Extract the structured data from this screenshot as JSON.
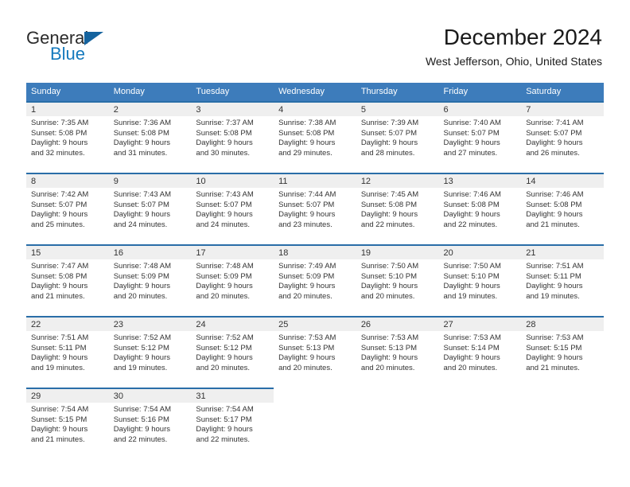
{
  "brand": {
    "name_part1": "General",
    "name_part2": "Blue",
    "triangle_icon": "triangle-icon",
    "accent_color": "#1479bd",
    "header_color": "#3d7cbb"
  },
  "header": {
    "title": "December 2024",
    "subtitle": "West Jefferson, Ohio, United States"
  },
  "calendar": {
    "weekday_headers": [
      "Sunday",
      "Monday",
      "Tuesday",
      "Wednesday",
      "Thursday",
      "Friday",
      "Saturday"
    ],
    "labels": {
      "sunrise_prefix": "Sunrise:",
      "sunset_prefix": "Sunset:",
      "daylight_prefix": "Daylight:"
    },
    "weeks": [
      [
        {
          "day": "1",
          "line1": "Sunrise: 7:35 AM",
          "line2": "Sunset: 5:08 PM",
          "line3": "Daylight: 9 hours",
          "line4": "and 32 minutes."
        },
        {
          "day": "2",
          "line1": "Sunrise: 7:36 AM",
          "line2": "Sunset: 5:08 PM",
          "line3": "Daylight: 9 hours",
          "line4": "and 31 minutes."
        },
        {
          "day": "3",
          "line1": "Sunrise: 7:37 AM",
          "line2": "Sunset: 5:08 PM",
          "line3": "Daylight: 9 hours",
          "line4": "and 30 minutes."
        },
        {
          "day": "4",
          "line1": "Sunrise: 7:38 AM",
          "line2": "Sunset: 5:08 PM",
          "line3": "Daylight: 9 hours",
          "line4": "and 29 minutes."
        },
        {
          "day": "5",
          "line1": "Sunrise: 7:39 AM",
          "line2": "Sunset: 5:07 PM",
          "line3": "Daylight: 9 hours",
          "line4": "and 28 minutes."
        },
        {
          "day": "6",
          "line1": "Sunrise: 7:40 AM",
          "line2": "Sunset: 5:07 PM",
          "line3": "Daylight: 9 hours",
          "line4": "and 27 minutes."
        },
        {
          "day": "7",
          "line1": "Sunrise: 7:41 AM",
          "line2": "Sunset: 5:07 PM",
          "line3": "Daylight: 9 hours",
          "line4": "and 26 minutes."
        }
      ],
      [
        {
          "day": "8",
          "line1": "Sunrise: 7:42 AM",
          "line2": "Sunset: 5:07 PM",
          "line3": "Daylight: 9 hours",
          "line4": "and 25 minutes."
        },
        {
          "day": "9",
          "line1": "Sunrise: 7:43 AM",
          "line2": "Sunset: 5:07 PM",
          "line3": "Daylight: 9 hours",
          "line4": "and 24 minutes."
        },
        {
          "day": "10",
          "line1": "Sunrise: 7:43 AM",
          "line2": "Sunset: 5:07 PM",
          "line3": "Daylight: 9 hours",
          "line4": "and 24 minutes."
        },
        {
          "day": "11",
          "line1": "Sunrise: 7:44 AM",
          "line2": "Sunset: 5:07 PM",
          "line3": "Daylight: 9 hours",
          "line4": "and 23 minutes."
        },
        {
          "day": "12",
          "line1": "Sunrise: 7:45 AM",
          "line2": "Sunset: 5:08 PM",
          "line3": "Daylight: 9 hours",
          "line4": "and 22 minutes."
        },
        {
          "day": "13",
          "line1": "Sunrise: 7:46 AM",
          "line2": "Sunset: 5:08 PM",
          "line3": "Daylight: 9 hours",
          "line4": "and 22 minutes."
        },
        {
          "day": "14",
          "line1": "Sunrise: 7:46 AM",
          "line2": "Sunset: 5:08 PM",
          "line3": "Daylight: 9 hours",
          "line4": "and 21 minutes."
        }
      ],
      [
        {
          "day": "15",
          "line1": "Sunrise: 7:47 AM",
          "line2": "Sunset: 5:08 PM",
          "line3": "Daylight: 9 hours",
          "line4": "and 21 minutes."
        },
        {
          "day": "16",
          "line1": "Sunrise: 7:48 AM",
          "line2": "Sunset: 5:09 PM",
          "line3": "Daylight: 9 hours",
          "line4": "and 20 minutes."
        },
        {
          "day": "17",
          "line1": "Sunrise: 7:48 AM",
          "line2": "Sunset: 5:09 PM",
          "line3": "Daylight: 9 hours",
          "line4": "and 20 minutes."
        },
        {
          "day": "18",
          "line1": "Sunrise: 7:49 AM",
          "line2": "Sunset: 5:09 PM",
          "line3": "Daylight: 9 hours",
          "line4": "and 20 minutes."
        },
        {
          "day": "19",
          "line1": "Sunrise: 7:50 AM",
          "line2": "Sunset: 5:10 PM",
          "line3": "Daylight: 9 hours",
          "line4": "and 20 minutes."
        },
        {
          "day": "20",
          "line1": "Sunrise: 7:50 AM",
          "line2": "Sunset: 5:10 PM",
          "line3": "Daylight: 9 hours",
          "line4": "and 19 minutes."
        },
        {
          "day": "21",
          "line1": "Sunrise: 7:51 AM",
          "line2": "Sunset: 5:11 PM",
          "line3": "Daylight: 9 hours",
          "line4": "and 19 minutes."
        }
      ],
      [
        {
          "day": "22",
          "line1": "Sunrise: 7:51 AM",
          "line2": "Sunset: 5:11 PM",
          "line3": "Daylight: 9 hours",
          "line4": "and 19 minutes."
        },
        {
          "day": "23",
          "line1": "Sunrise: 7:52 AM",
          "line2": "Sunset: 5:12 PM",
          "line3": "Daylight: 9 hours",
          "line4": "and 19 minutes."
        },
        {
          "day": "24",
          "line1": "Sunrise: 7:52 AM",
          "line2": "Sunset: 5:12 PM",
          "line3": "Daylight: 9 hours",
          "line4": "and 20 minutes."
        },
        {
          "day": "25",
          "line1": "Sunrise: 7:53 AM",
          "line2": "Sunset: 5:13 PM",
          "line3": "Daylight: 9 hours",
          "line4": "and 20 minutes."
        },
        {
          "day": "26",
          "line1": "Sunrise: 7:53 AM",
          "line2": "Sunset: 5:13 PM",
          "line3": "Daylight: 9 hours",
          "line4": "and 20 minutes."
        },
        {
          "day": "27",
          "line1": "Sunrise: 7:53 AM",
          "line2": "Sunset: 5:14 PM",
          "line3": "Daylight: 9 hours",
          "line4": "and 20 minutes."
        },
        {
          "day": "28",
          "line1": "Sunrise: 7:53 AM",
          "line2": "Sunset: 5:15 PM",
          "line3": "Daylight: 9 hours",
          "line4": "and 21 minutes."
        }
      ],
      [
        {
          "day": "29",
          "line1": "Sunrise: 7:54 AM",
          "line2": "Sunset: 5:15 PM",
          "line3": "Daylight: 9 hours",
          "line4": "and 21 minutes."
        },
        {
          "day": "30",
          "line1": "Sunrise: 7:54 AM",
          "line2": "Sunset: 5:16 PM",
          "line3": "Daylight: 9 hours",
          "line4": "and 22 minutes."
        },
        {
          "day": "31",
          "line1": "Sunrise: 7:54 AM",
          "line2": "Sunset: 5:17 PM",
          "line3": "Daylight: 9 hours",
          "line4": "and 22 minutes."
        },
        {
          "day": "",
          "line1": "",
          "line2": "",
          "line3": "",
          "line4": ""
        },
        {
          "day": "",
          "line1": "",
          "line2": "",
          "line3": "",
          "line4": ""
        },
        {
          "day": "",
          "line1": "",
          "line2": "",
          "line3": "",
          "line4": ""
        },
        {
          "day": "",
          "line1": "",
          "line2": "",
          "line3": "",
          "line4": ""
        }
      ]
    ]
  }
}
